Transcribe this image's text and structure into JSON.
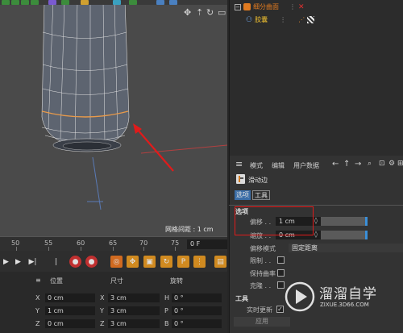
{
  "viewport": {
    "grid_spacing_label": "网格间距 : 1 cm"
  },
  "timeline": {
    "ticks": [
      "50",
      "55",
      "60",
      "65",
      "70",
      "75"
    ],
    "frame_value": "0 F"
  },
  "coordinates": {
    "headers": {
      "position": "位置",
      "size": "尺寸",
      "rotation": "旋转"
    },
    "rows": [
      {
        "axis": "X",
        "pos": "0 cm",
        "size_axis": "X",
        "size": "3 cm",
        "rot_axis": "H",
        "rot": "0 °"
      },
      {
        "axis": "Y",
        "pos": "1 cm",
        "size_axis": "Y",
        "size": "3 cm",
        "rot_axis": "P",
        "rot": "0 °"
      },
      {
        "axis": "Z",
        "pos": "0 cm",
        "size_axis": "Z",
        "size": "3 cm",
        "rot_axis": "B",
        "rot": "0 °"
      }
    ]
  },
  "object_manager": {
    "objects": [
      {
        "name": "细分曲面",
        "icon": "subdivision-icon",
        "color": "#e07a20"
      },
      {
        "name": "胶囊",
        "icon": "capsule-icon",
        "color": "#f0c030"
      }
    ]
  },
  "attributes": {
    "menu": [
      "模式",
      "编辑",
      "用户数据"
    ],
    "tool_name": "滑动边",
    "tabs": [
      "选项",
      "工具"
    ],
    "section_options": "选项",
    "offset_label": "偏移 . .",
    "offset_value": "1 cm",
    "scale_label": "缩放 . .",
    "scale_value": "0 cm",
    "offset_mode_label": "偏移模式",
    "offset_mode_value": "固定距离",
    "limit_label": "限制 . .",
    "keep_curvature_label": "保持曲率",
    "clone_label": "克隆 . .",
    "section_tool": "工具",
    "realtime_label": "实时更新",
    "apply_label": "应用"
  },
  "watermark": {
    "brand": "溜溜自学",
    "url": "ZIXUE.3D66.COM"
  },
  "colors": {
    "accent_blue": "#3b8fd8",
    "highlight_red": "#e01b1b",
    "selection_orange": "#e08a30"
  }
}
